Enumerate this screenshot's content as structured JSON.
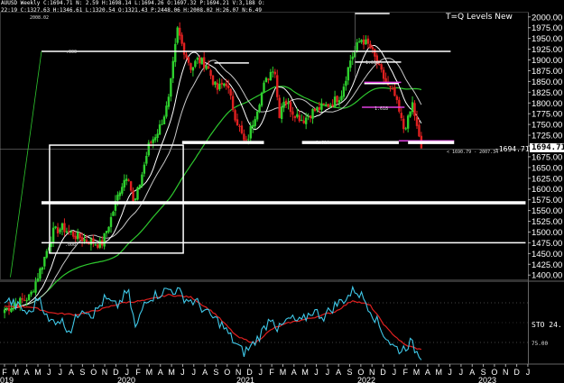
{
  "header": {
    "line1": "AUUSD Weekly C:1694.71 N: 2.59 H:1698.14 L:1694.26 O:1697.32 P:1694.21 V:3,188 O:",
    "line2": "22:19 C:1327.63 H:1346.61 L:1320.54 O:1321.43 P:2448.06 H:2008.02 H:26.07 N:6.49"
  },
  "levels_title": "T=Q Levels New",
  "current_price_label": "1694.71",
  "annotations": {
    "top_small": "2008.02",
    "left_small": ".000",
    "fib_a": "1.618",
    "fib_b": "1.618",
    "fib_c": "1.618",
    "box_small": ".000",
    "range_note": "< 1690.79 - 2007.34",
    "current_note": "-1694.71"
  },
  "indicator": {
    "label": "STO 24.",
    "tick_label": "75.00"
  },
  "colors": {
    "candle_up": "#2ed12e",
    "candle_down": "#e02020",
    "ma_green": "#2ec82e",
    "ma_white": "#ffffff",
    "ma_gray": "#c8c8c8",
    "level_white": "#ffffff",
    "level_magenta": "#e040e0",
    "sto_cyan": "#3fc8e8",
    "sto_red": "#e02020"
  },
  "chart_data": {
    "type": "candlestick",
    "symbol": "AUUSD",
    "timeframe": "Weekly",
    "ylim": [
      1390,
      2010
    ],
    "y_ticks": [
      1400.0,
      1425.0,
      1450.0,
      1475.0,
      1500.0,
      1525.0,
      1550.0,
      1575.0,
      1600.0,
      1625.0,
      1650.0,
      1675.0,
      1700.0,
      1725.0,
      1750.0,
      1775.0,
      1800.0,
      1825.0,
      1850.0,
      1875.0,
      1900.0,
      1925.0,
      1950.0,
      1975.0,
      2000.0
    ],
    "x_month_labels": [
      "F",
      "M",
      "A",
      "M",
      "J",
      "J",
      "A",
      "S",
      "O",
      "N",
      "D",
      "J",
      "F",
      "M",
      "A",
      "M",
      "J",
      "J",
      "A",
      "S",
      "O",
      "N",
      "D",
      "J",
      "F",
      "M",
      "A",
      "M",
      "J",
      "J",
      "A",
      "S",
      "O",
      "N",
      "D",
      "J",
      "F",
      "M",
      "A",
      "M",
      "J",
      "J",
      "A",
      "S",
      "O",
      "N",
      "D",
      "J",
      "F",
      "M",
      "A",
      "M"
    ],
    "x_year_labels": [
      "019",
      "2020",
      "2021",
      "2022",
      "2023"
    ],
    "close_path": [
      [
        2019.08,
        1320
      ],
      [
        2019.3,
        1350
      ],
      [
        2019.4,
        1420
      ],
      [
        2019.5,
        1500
      ],
      [
        2019.58,
        1510
      ],
      [
        2019.7,
        1490
      ],
      [
        2019.8,
        1480
      ],
      [
        2019.92,
        1470
      ],
      [
        2020.0,
        1530
      ],
      [
        2020.08,
        1600
      ],
      [
        2020.15,
        1640
      ],
      [
        2020.2,
        1560
      ],
      [
        2020.25,
        1610
      ],
      [
        2020.33,
        1700
      ],
      [
        2020.42,
        1740
      ],
      [
        2020.5,
        1800
      ],
      [
        2020.58,
        1970
      ],
      [
        2020.62,
        1935
      ],
      [
        2020.7,
        1880
      ],
      [
        2020.75,
        1900
      ],
      [
        2020.83,
        1890
      ],
      [
        2020.92,
        1830
      ],
      [
        2021.0,
        1850
      ],
      [
        2021.08,
        1770
      ],
      [
        2021.17,
        1700
      ],
      [
        2021.25,
        1770
      ],
      [
        2021.33,
        1840
      ],
      [
        2021.42,
        1890
      ],
      [
        2021.46,
        1770
      ],
      [
        2021.5,
        1810
      ],
      [
        2021.58,
        1780
      ],
      [
        2021.67,
        1760
      ],
      [
        2021.75,
        1780
      ],
      [
        2021.83,
        1790
      ],
      [
        2021.92,
        1800
      ],
      [
        2022.0,
        1820
      ],
      [
        2022.08,
        1900
      ],
      [
        2022.17,
        1950
      ],
      [
        2022.25,
        1930
      ],
      [
        2022.33,
        1880
      ],
      [
        2022.4,
        1840
      ],
      [
        2022.46,
        1820
      ],
      [
        2022.54,
        1740
      ],
      [
        2022.58,
        1760
      ],
      [
        2022.62,
        1800
      ],
      [
        2022.67,
        1720
      ],
      [
        2022.71,
        1694.71
      ]
    ],
    "horizontal_levels": [
      {
        "price": 2008.02,
        "style": "white",
        "from": 2022.12,
        "to": 2022.42
      },
      {
        "price": 1920,
        "style": "white",
        "from": 2019.4,
        "to": 2022.95
      },
      {
        "price": 1895,
        "style": "white",
        "from": 2022.12,
        "to": 2022.52
      },
      {
        "price": 1893,
        "style": "white",
        "from": 2020.9,
        "to": 2021.2
      },
      {
        "price": 1848,
        "style": "magenta",
        "from": 2022.2,
        "to": 2022.52
      },
      {
        "price": 1845,
        "style": "white",
        "from": 2022.2,
        "to": 2022.5
      },
      {
        "price": 1790,
        "style": "magenta",
        "from": 2022.18,
        "to": 2022.55
      },
      {
        "price": 1708,
        "style": "white-thick",
        "from": 2020.62,
        "to": 2021.33
      },
      {
        "price": 1708,
        "style": "white-thick",
        "from": 2021.66,
        "to": 2022.5
      },
      {
        "price": 1712,
        "style": "magenta",
        "from": 2022.5,
        "to": 2022.98
      },
      {
        "price": 1708,
        "style": "white-thick",
        "from": 2022.58,
        "to": 2022.98
      },
      {
        "price": 1568,
        "style": "white-thick",
        "from": 2019.4,
        "to": 2023.6
      },
      {
        "price": 1475,
        "style": "white",
        "from": 2019.4,
        "to": 2023.6
      },
      {
        "price": 1693,
        "style": "thin-gray",
        "from": 2018.95,
        "to": 2023.6
      }
    ],
    "box": {
      "x0": 2019.47,
      "x1": 2020.63,
      "y0": 1451,
      "y1": 1702
    },
    "indicator": {
      "name": "STO",
      "value": 24,
      "ylim": [
        0,
        100
      ],
      "cyan": [
        [
          2019.08,
          80
        ],
        [
          2019.2,
          70
        ],
        [
          2019.3,
          60
        ],
        [
          2019.38,
          85
        ],
        [
          2019.46,
          50
        ],
        [
          2019.55,
          55
        ],
        [
          2019.65,
          40
        ],
        [
          2019.75,
          70
        ],
        [
          2019.85,
          60
        ],
        [
          2019.95,
          80
        ],
        [
          2020.05,
          70
        ],
        [
          2020.15,
          90
        ],
        [
          2020.22,
          40
        ],
        [
          2020.3,
          80
        ],
        [
          2020.4,
          85
        ],
        [
          2020.5,
          92
        ],
        [
          2020.58,
          90
        ],
        [
          2020.65,
          80
        ],
        [
          2020.75,
          75
        ],
        [
          2020.85,
          60
        ],
        [
          2020.95,
          50
        ],
        [
          2021.05,
          30
        ],
        [
          2021.15,
          12
        ],
        [
          2021.22,
          20
        ],
        [
          2021.3,
          35
        ],
        [
          2021.4,
          60
        ],
        [
          2021.45,
          40
        ],
        [
          2021.55,
          55
        ],
        [
          2021.65,
          50
        ],
        [
          2021.75,
          65
        ],
        [
          2021.85,
          58
        ],
        [
          2021.95,
          72
        ],
        [
          2022.05,
          82
        ],
        [
          2022.12,
          92
        ],
        [
          2022.2,
          80
        ],
        [
          2022.28,
          60
        ],
        [
          2022.35,
          40
        ],
        [
          2022.45,
          20
        ],
        [
          2022.52,
          15
        ],
        [
          2022.6,
          25
        ],
        [
          2022.66,
          12
        ],
        [
          2022.71,
          8
        ]
      ],
      "red": [
        [
          2019.08,
          70
        ],
        [
          2019.3,
          70
        ],
        [
          2019.5,
          62
        ],
        [
          2019.7,
          60
        ],
        [
          2019.9,
          66
        ],
        [
          2020.1,
          75
        ],
        [
          2020.3,
          78
        ],
        [
          2020.5,
          85
        ],
        [
          2020.7,
          82
        ],
        [
          2020.9,
          62
        ],
        [
          2021.1,
          32
        ],
        [
          2021.25,
          24
        ],
        [
          2021.4,
          42
        ],
        [
          2021.55,
          50
        ],
        [
          2021.75,
          56
        ],
        [
          2021.95,
          64
        ],
        [
          2022.1,
          78
        ],
        [
          2022.25,
          72
        ],
        [
          2022.4,
          42
        ],
        [
          2022.55,
          22
        ],
        [
          2022.71,
          15
        ]
      ]
    }
  }
}
